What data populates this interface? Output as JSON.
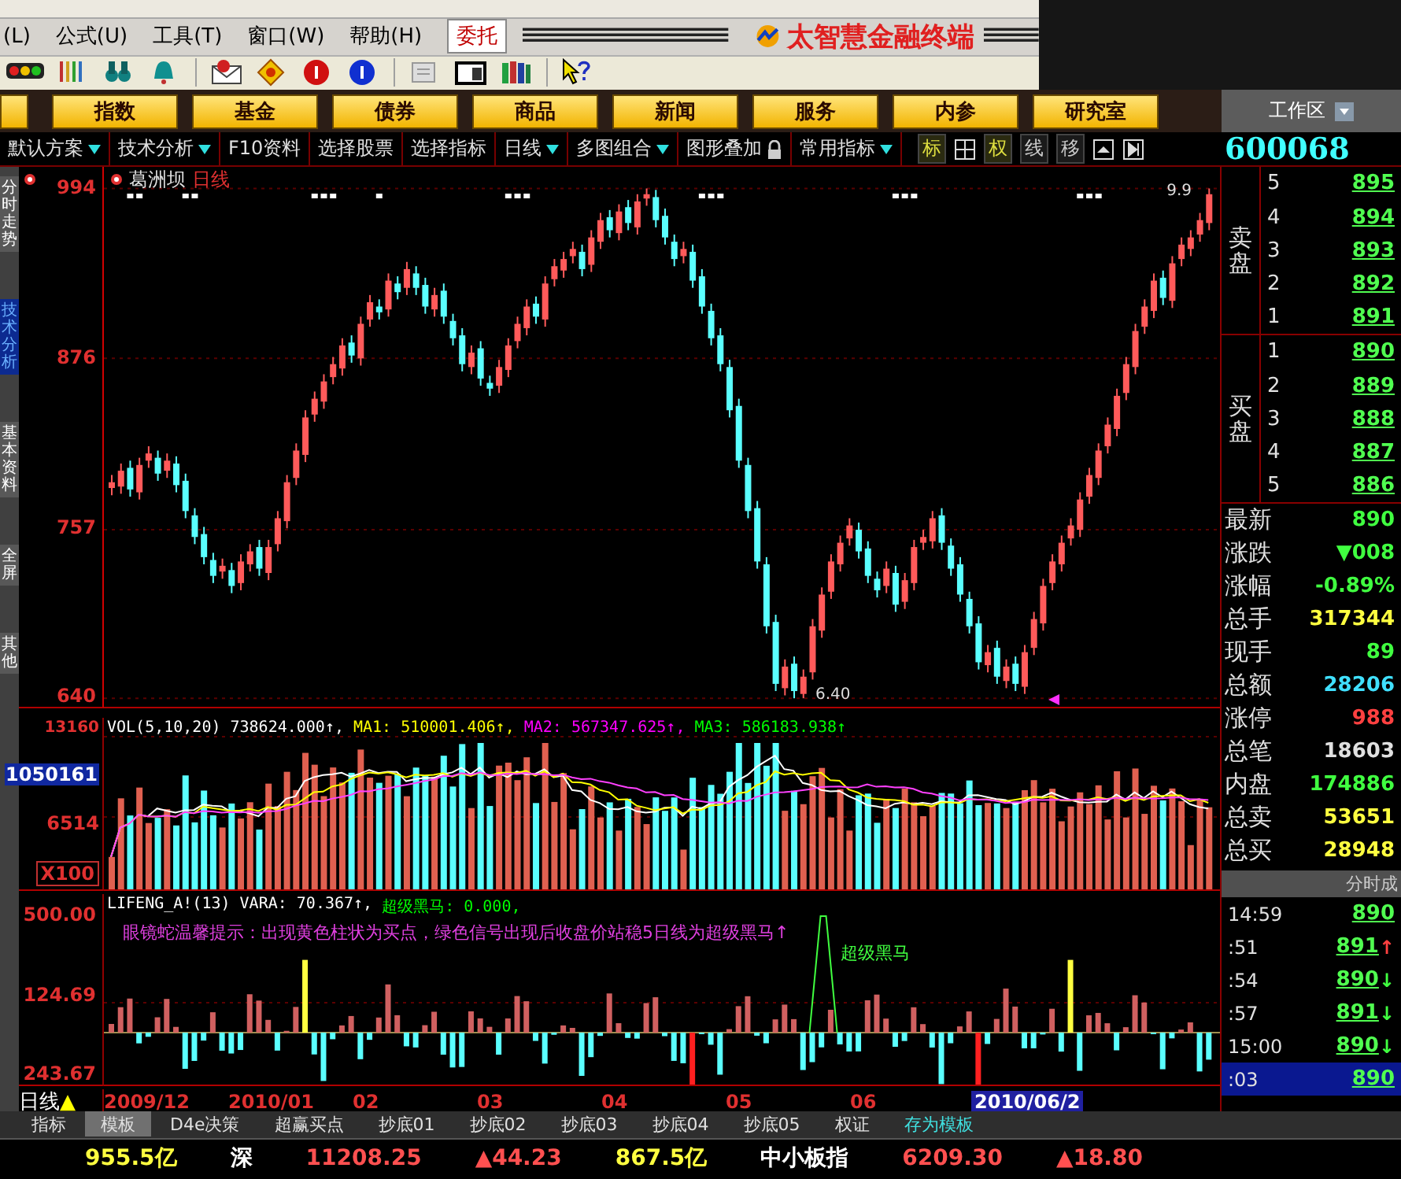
{
  "menu_bar": {
    "items": [
      "(L)",
      "公式(U)",
      "工具(T)",
      "窗口(W)",
      "帮助(H)"
    ],
    "order_button": "委托",
    "brand": "太智慧金融终端"
  },
  "nav_buttons": [
    "指数",
    "基金",
    "债券",
    "商品",
    "新闻",
    "服务",
    "内参",
    "研究室"
  ],
  "workspace": "工作区",
  "chart_tabs": [
    {
      "label": "默认方案",
      "dropdown": true,
      "locked": false
    },
    {
      "label": "技术分析",
      "dropdown": true,
      "locked": false
    },
    {
      "label": "F10资料",
      "dropdown": false,
      "locked": false
    },
    {
      "label": "选择股票",
      "dropdown": false,
      "locked": false
    },
    {
      "label": "选择指标",
      "dropdown": false,
      "locked": false
    },
    {
      "label": "日线",
      "dropdown": true,
      "locked": false
    },
    {
      "label": "多图组合",
      "dropdown": true,
      "locked": false
    },
    {
      "label": "图形叠加",
      "dropdown": false,
      "locked": true
    },
    {
      "label": "常用指标",
      "dropdown": true,
      "locked": false
    }
  ],
  "chart_toggles": [
    {
      "kind": "text",
      "label": "标",
      "active": true
    },
    {
      "kind": "grid"
    },
    {
      "kind": "text",
      "label": "权",
      "active": true
    },
    {
      "kind": "text",
      "label": "线",
      "active": false
    },
    {
      "kind": "text",
      "label": "移",
      "active": false
    },
    {
      "kind": "expand"
    },
    {
      "kind": "play"
    }
  ],
  "stock_code": "600068",
  "sidebar_tabs": [
    {
      "label": "分时走势",
      "selected": false
    },
    {
      "label": "技术分析",
      "selected": true
    },
    {
      "label": "基本资料",
      "selected": false
    },
    {
      "label": "全屏",
      "selected": false
    },
    {
      "label": "其他",
      "selected": false
    }
  ],
  "price_chart": {
    "stock_name": "葛洲坝",
    "period": "日线",
    "high_label": "9.9",
    "low_label": "6.40",
    "chart_data": {
      "type": "candlestick",
      "ylim": [
        633,
        1009
      ],
      "yticks": [
        994,
        876,
        757,
        640
      ],
      "grid": true,
      "ohlc": [
        [
          786,
          795,
          781,
          790
        ],
        [
          787,
          803,
          782,
          798
        ],
        [
          800,
          805,
          780,
          785
        ],
        [
          783,
          807,
          778,
          802
        ],
        [
          805,
          815,
          800,
          810
        ],
        [
          807,
          812,
          791,
          796
        ],
        [
          798,
          810,
          793,
          805
        ],
        [
          803,
          808,
          783,
          788
        ],
        [
          791,
          796,
          765,
          770
        ],
        [
          767,
          772,
          747,
          752
        ],
        [
          754,
          759,
          733,
          738
        ],
        [
          736,
          741,
          720,
          725
        ],
        [
          728,
          737,
          723,
          732
        ],
        [
          729,
          734,
          713,
          718
        ],
        [
          720,
          740,
          715,
          735
        ],
        [
          733,
          747,
          728,
          742
        ],
        [
          745,
          750,
          725,
          730
        ],
        [
          727,
          750,
          722,
          745
        ],
        [
          747,
          770,
          742,
          765
        ],
        [
          763,
          795,
          758,
          790
        ],
        [
          793,
          817,
          788,
          812
        ],
        [
          809,
          840,
          804,
          835
        ],
        [
          837,
          853,
          832,
          848
        ],
        [
          846,
          865,
          841,
          860
        ],
        [
          863,
          877,
          858,
          872
        ],
        [
          869,
          890,
          864,
          885
        ],
        [
          887,
          892,
          873,
          878
        ],
        [
          876,
          905,
          871,
          900
        ],
        [
          903,
          920,
          898,
          915
        ],
        [
          912,
          917,
          903,
          908
        ],
        [
          910,
          935,
          905,
          930
        ],
        [
          928,
          933,
          917,
          922
        ],
        [
          925,
          943,
          920,
          938
        ],
        [
          935,
          940,
          920,
          925
        ],
        [
          927,
          932,
          907,
          912
        ],
        [
          910,
          925,
          905,
          920
        ],
        [
          923,
          928,
          900,
          905
        ],
        [
          902,
          907,
          885,
          890
        ],
        [
          892,
          897,
          867,
          872
        ],
        [
          870,
          885,
          865,
          880
        ],
        [
          883,
          888,
          857,
          862
        ],
        [
          859,
          864,
          850,
          855
        ],
        [
          857,
          875,
          852,
          870
        ],
        [
          868,
          890,
          863,
          885
        ],
        [
          888,
          905,
          883,
          900
        ],
        [
          897,
          917,
          892,
          912
        ],
        [
          914,
          919,
          900,
          905
        ],
        [
          903,
          933,
          898,
          928
        ],
        [
          931,
          945,
          926,
          940
        ],
        [
          937,
          950,
          932,
          945
        ],
        [
          947,
          957,
          942,
          952
        ],
        [
          950,
          955,
          933,
          938
        ],
        [
          941,
          965,
          936,
          960
        ],
        [
          957,
          977,
          952,
          972
        ],
        [
          974,
          979,
          960,
          965
        ],
        [
          963,
          983,
          958,
          978
        ],
        [
          981,
          986,
          965,
          970
        ],
        [
          967,
          990,
          962,
          985
        ],
        [
          987,
          994,
          982,
          990
        ],
        [
          988,
          993,
          967,
          972
        ],
        [
          975,
          980,
          955,
          960
        ],
        [
          957,
          962,
          940,
          945
        ],
        [
          947,
          957,
          942,
          952
        ],
        [
          950,
          955,
          925,
          930
        ],
        [
          933,
          938,
          907,
          912
        ],
        [
          909,
          914,
          885,
          890
        ],
        [
          892,
          897,
          867,
          872
        ],
        [
          870,
          875,
          835,
          840
        ],
        [
          843,
          848,
          800,
          805
        ],
        [
          802,
          807,
          765,
          770
        ],
        [
          772,
          777,
          730,
          735
        ],
        [
          733,
          738,
          685,
          690
        ],
        [
          693,
          698,
          645,
          650
        ],
        [
          647,
          667,
          642,
          662
        ],
        [
          664,
          669,
          640,
          645
        ],
        [
          643,
          660,
          640,
          655
        ],
        [
          658,
          695,
          653,
          690
        ],
        [
          687,
          717,
          682,
          712
        ],
        [
          714,
          740,
          709,
          735
        ],
        [
          733,
          753,
          728,
          748
        ],
        [
          751,
          765,
          746,
          760
        ],
        [
          757,
          762,
          737,
          742
        ],
        [
          744,
          749,
          720,
          725
        ],
        [
          723,
          728,
          710,
          715
        ],
        [
          718,
          735,
          713,
          730
        ],
        [
          727,
          732,
          700,
          705
        ],
        [
          707,
          727,
          702,
          722
        ],
        [
          720,
          750,
          715,
          745
        ],
        [
          748,
          757,
          743,
          752
        ],
        [
          749,
          770,
          744,
          765
        ],
        [
          767,
          772,
          743,
          748
        ],
        [
          746,
          751,
          725,
          730
        ],
        [
          733,
          738,
          707,
          712
        ],
        [
          709,
          714,
          685,
          690
        ],
        [
          692,
          697,
          660,
          665
        ],
        [
          663,
          677,
          658,
          672
        ],
        [
          675,
          680,
          650,
          655
        ],
        [
          652,
          667,
          647,
          662
        ],
        [
          664,
          669,
          645,
          650
        ],
        [
          648,
          677,
          643,
          672
        ],
        [
          675,
          700,
          670,
          695
        ],
        [
          692,
          723,
          687,
          718
        ],
        [
          720,
          740,
          715,
          735
        ],
        [
          733,
          753,
          728,
          748
        ],
        [
          751,
          765,
          746,
          760
        ],
        [
          757,
          783,
          752,
          778
        ],
        [
          780,
          800,
          775,
          795
        ],
        [
          793,
          817,
          788,
          812
        ],
        [
          815,
          835,
          810,
          830
        ],
        [
          827,
          855,
          822,
          850
        ],
        [
          852,
          877,
          847,
          872
        ],
        [
          870,
          900,
          865,
          895
        ],
        [
          898,
          917,
          893,
          912
        ],
        [
          909,
          935,
          904,
          930
        ],
        [
          932,
          937,
          913,
          918
        ],
        [
          916,
          947,
          911,
          942
        ],
        [
          945,
          960,
          940,
          955
        ],
        [
          952,
          965,
          947,
          960
        ],
        [
          962,
          977,
          957,
          972
        ],
        [
          970,
          994,
          965,
          990
        ]
      ]
    }
  },
  "volume_panel": {
    "header": [
      {
        "text": "VOL(5,10,20)",
        "color": "#ffffff"
      },
      {
        "text": "738624.000↑,",
        "color": "#ffffff"
      },
      {
        "text": "MA1: 510001.406↑,",
        "color": "#ffff00"
      },
      {
        "text": "MA2: 567347.625↑,",
        "color": "#ff00ff"
      },
      {
        "text": "MA3: 586183.938↑",
        "color": "#00ff00"
      }
    ],
    "y_labels": [
      "13160",
      "6514",
      "X100"
    ],
    "cursor_value": "1050161"
  },
  "indicator_panel": {
    "header": [
      {
        "text": "LIFENG_A!(13)",
        "color": "#ffffff"
      },
      {
        "text": "VARA: 70.367↑,",
        "color": "#ffffff"
      },
      {
        "text": "超级黑马: 0.000,",
        "color": "#00ff00"
      }
    ],
    "hint": "眼镜蛇温馨提示：出现黄色柱状为买点，绿色信号出现后收盘价站稳5日线为超级黑马↑",
    "signal_label": "超级黑马",
    "y_labels": [
      "500.00",
      "124.69",
      "243.67"
    ]
  },
  "date_axis": {
    "period": "日线",
    "marker": "▲",
    "dates": [
      "2009/12",
      "2010/01",
      "02",
      "03",
      "04",
      "05",
      "06"
    ],
    "cursor_date": "2010/06/2"
  },
  "order_book": {
    "sell_label": "卖盘",
    "buy_label": "买盘",
    "sell": [
      {
        "level": "5",
        "price": "895"
      },
      {
        "level": "4",
        "price": "894"
      },
      {
        "level": "3",
        "price": "893"
      },
      {
        "level": "2",
        "price": "892"
      },
      {
        "level": "1",
        "price": "891"
      }
    ],
    "buy": [
      {
        "level": "1",
        "price": "890"
      },
      {
        "level": "2",
        "price": "889"
      },
      {
        "level": "3",
        "price": "888"
      },
      {
        "level": "4",
        "price": "887"
      },
      {
        "level": "5",
        "price": "886"
      }
    ]
  },
  "quote_stats": [
    {
      "label": "最新",
      "value": "890",
      "color": "#40ff40"
    },
    {
      "label": "涨跌",
      "value": "▼008",
      "color": "#40ff40"
    },
    {
      "label": "涨幅",
      "value": "-0.89%",
      "color": "#40ff40"
    },
    {
      "label": "总手",
      "value": "317344",
      "color": "#ffff40"
    },
    {
      "label": "现手",
      "value": "89",
      "color": "#40ff40"
    },
    {
      "label": "总额",
      "value": "28206",
      "color": "#40e0ff"
    },
    {
      "label": "涨停",
      "value": "988",
      "color": "#ff4040"
    },
    {
      "label": "总笔",
      "value": "18603",
      "color": "#e0e0e0"
    },
    {
      "label": "内盘",
      "value": "174886",
      "color": "#40ff40"
    },
    {
      "label": "总卖",
      "value": "53651",
      "color": "#ffff40"
    },
    {
      "label": "总买",
      "value": "28948",
      "color": "#ffff40"
    }
  ],
  "ticks": {
    "title": "分时成",
    "rows": [
      {
        "time": "14:59",
        "price": "890",
        "selected": false
      },
      {
        "time": ":51",
        "price": "891",
        "arrow": "↑",
        "color": "#ff4040",
        "selected": false
      },
      {
        "time": ":54",
        "price": "890",
        "arrow": "↓",
        "color": "#40ff40",
        "selected": false
      },
      {
        "time": ":57",
        "price": "891",
        "arrow": "↓",
        "color": "#40ff40",
        "selected": false
      },
      {
        "time": "15:00",
        "price": "890",
        "arrow": "↓",
        "color": "#40ff40",
        "selected": false
      },
      {
        "time": ":03",
        "price": "890",
        "selected": true
      }
    ]
  },
  "template_tabs": [
    {
      "label": "指标",
      "kind": "tab",
      "selected": false
    },
    {
      "label": "模板",
      "kind": "tab",
      "selected": true
    },
    {
      "label": "D4e决策",
      "kind": "tab",
      "selected": false
    },
    {
      "label": "超赢买点",
      "kind": "tab",
      "selected": false
    },
    {
      "label": "抄底01",
      "kind": "tab",
      "selected": false
    },
    {
      "label": "抄底02",
      "kind": "tab",
      "selected": false
    },
    {
      "label": "抄底03",
      "kind": "tab",
      "selected": false
    },
    {
      "label": "抄底04",
      "kind": "tab",
      "selected": false
    },
    {
      "label": "抄底05",
      "kind": "tab",
      "selected": false
    },
    {
      "label": "权证",
      "kind": "tab",
      "selected": false
    },
    {
      "label": "存为模板",
      "kind": "action",
      "selected": false
    }
  ],
  "status_bar": [
    {
      "text": "955.5亿",
      "color": "#ffff40"
    },
    {
      "text": "深",
      "color": "#ffffff"
    },
    {
      "text": "11208.25",
      "color": "#ff5050"
    },
    {
      "text": "▲44.23",
      "color": "#ff5050"
    },
    {
      "text": "867.5亿",
      "color": "#ffff40"
    },
    {
      "text": "中小板指",
      "color": "#ffffff"
    },
    {
      "text": "6209.30",
      "color": "#ff5050"
    },
    {
      "text": "▲18.80",
      "color": "#ff5050"
    }
  ]
}
